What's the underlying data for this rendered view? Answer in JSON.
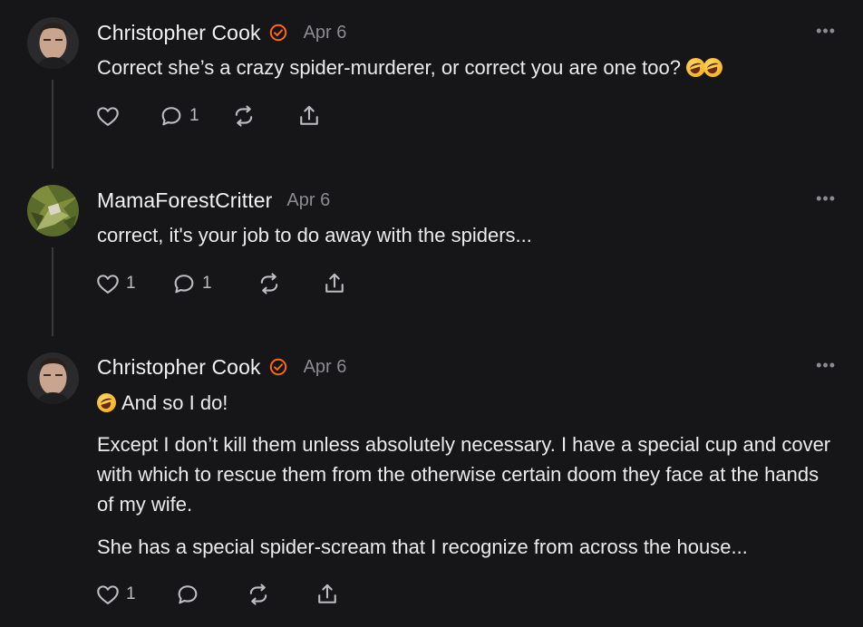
{
  "comments": [
    {
      "author": "Christopher Cook",
      "verified": true,
      "date": "Apr 6",
      "more": "•••",
      "paragraphs": [
        "Correct she’s a crazy spider-murderer, or correct you are one too?"
      ],
      "trailing_emoji": [
        "rolling-on-floor-laughing-emoji",
        "rolling-on-floor-laughing-emoji"
      ],
      "likes": "",
      "replies": "1"
    },
    {
      "author": "MamaForestCritter",
      "verified": false,
      "date": "Apr 6",
      "more": "•••",
      "paragraphs": [
        "correct, it's your job to do away with the spiders..."
      ],
      "likes": "1",
      "replies": "1"
    },
    {
      "author": "Christopher Cook",
      "verified": true,
      "date": "Apr 6",
      "more": "•••",
      "leading_emoji": "rolling-on-floor-laughing-emoji",
      "paragraphs": [
        "And so I do!",
        "Except I don’t kill them unless absolutely necessary. I have a special cup and cover with which to rescue them from the otherwise certain doom they face at the hands of my wife.",
        "She has a special spider-scream that I recognize from across the house..."
      ],
      "likes": "1",
      "replies": ""
    }
  ],
  "icons": {
    "like": "heart-icon",
    "reply": "comment-bubble-icon",
    "restack": "restack-arrows-icon",
    "share": "share-upload-icon",
    "verified": "verified-check-badge-icon"
  },
  "colors": {
    "background": "#161618",
    "text": "#ebebec",
    "muted": "#8c8c90",
    "verified_accent": "#ff6719"
  }
}
